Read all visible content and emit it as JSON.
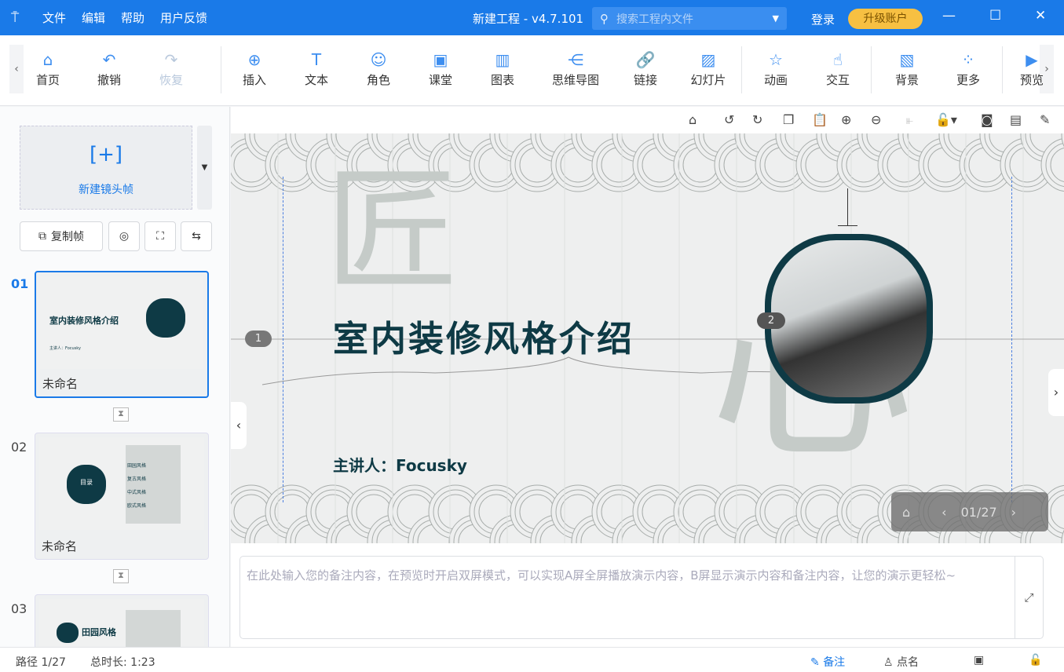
{
  "titlebar": {
    "logo_icon": "presentation-icon",
    "menus": [
      "文件",
      "编辑",
      "帮助",
      "用户反馈"
    ],
    "title": "新建工程 - v4.7.101",
    "search_placeholder": "搜索工程内文件",
    "login": "登录",
    "upgrade": "升级账户"
  },
  "toolbar": {
    "items": [
      {
        "label": "首页",
        "icon": "home-icon"
      },
      {
        "label": "撤销",
        "icon": "undo-icon"
      },
      {
        "label": "恢复",
        "icon": "redo-icon",
        "disabled": true
      },
      {
        "label": "插入",
        "icon": "plus-circle-icon"
      },
      {
        "label": "文本",
        "icon": "text-icon"
      },
      {
        "label": "角色",
        "icon": "character-icon"
      },
      {
        "label": "课堂",
        "icon": "classroom-icon"
      },
      {
        "label": "图表",
        "icon": "chart-icon"
      },
      {
        "label": "思维导图",
        "icon": "mindmap-icon"
      },
      {
        "label": "链接",
        "icon": "link-icon"
      },
      {
        "label": "幻灯片",
        "icon": "slide-icon"
      },
      {
        "label": "动画",
        "icon": "star-icon"
      },
      {
        "label": "交互",
        "icon": "tap-icon"
      },
      {
        "label": "背景",
        "icon": "background-icon"
      },
      {
        "label": "更多",
        "icon": "grid-icon"
      },
      {
        "label": "预览",
        "icon": "play-icon"
      }
    ]
  },
  "sidebar": {
    "new_frame": "新建镜头帧",
    "copy_frame": "复制帧",
    "slides": [
      {
        "num": "01",
        "name": "未命名",
        "title": "室内装修风格介绍",
        "presenter": "主讲人：Focusky"
      },
      {
        "num": "02",
        "name": "未命名",
        "toc": "目录",
        "items": [
          "田园风格",
          "复古风格",
          "中式风格",
          "欧式风格"
        ]
      },
      {
        "num": "03",
        "name": "",
        "title": "田园风格"
      }
    ]
  },
  "slide": {
    "title": "室内装修风格介绍",
    "presenter": "主讲人：Focusky",
    "big_char_1": "匠",
    "big_char_2": "心",
    "marker_1": "1",
    "marker_2": "2",
    "counter": "01/27",
    "theme_color": "#0e3a45"
  },
  "notes": {
    "placeholder": "在此处输入您的备注内容，在预览时开启双屏模式，可以实现A屏全屏播放演示内容，B屏显示演示内容和备注内容，让您的演示更轻松~"
  },
  "status": {
    "path": "路径 1/27",
    "duration": "总时长: 1:23",
    "notes": "备注",
    "rollcall": "点名"
  }
}
